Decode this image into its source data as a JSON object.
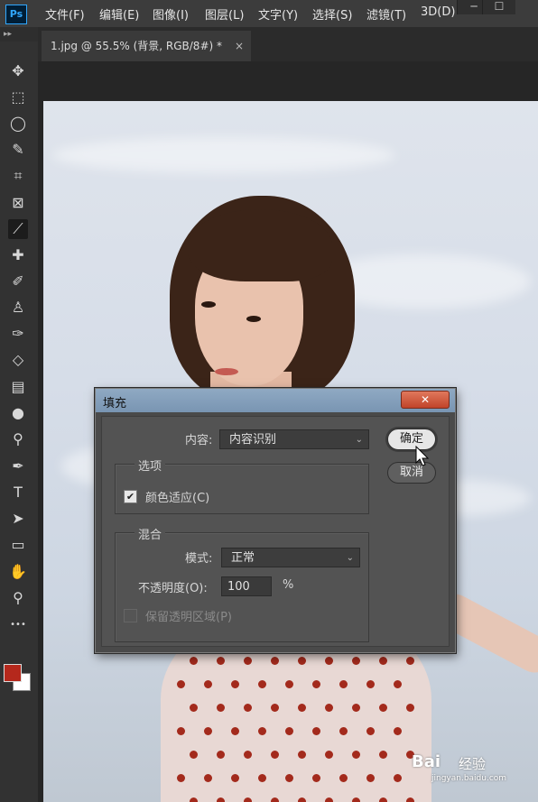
{
  "app": {
    "logo": "Ps",
    "menu": [
      "文件(F)",
      "编辑(E)",
      "图像(I)",
      "图层(L)",
      "文字(Y)",
      "选择(S)",
      "滤镜(T)",
      "3D(D)"
    ],
    "window_controls": {
      "minimize": "─",
      "maximize": "☐"
    }
  },
  "toolstrip": {
    "collapse": "▸▸"
  },
  "document": {
    "tab_title": "1.jpg @ 55.5% (背景, RGB/8#) *",
    "tab_close": "×"
  },
  "tools": [
    {
      "name": "move-tool-icon",
      "glyph": "✥"
    },
    {
      "name": "marquee-tool-icon",
      "glyph": "⬚"
    },
    {
      "name": "lasso-tool-icon",
      "glyph": "◯"
    },
    {
      "name": "quick-select-tool-icon",
      "glyph": "✎"
    },
    {
      "name": "crop-tool-icon",
      "glyph": "⌗"
    },
    {
      "name": "frame-tool-icon",
      "glyph": "⊠"
    },
    {
      "name": "eyedropper-tool-icon",
      "glyph": "⟋"
    },
    {
      "name": "healing-brush-tool-icon",
      "glyph": "✚"
    },
    {
      "name": "brush-tool-icon",
      "glyph": "✐"
    },
    {
      "name": "stamp-tool-icon",
      "glyph": "♙"
    },
    {
      "name": "history-brush-tool-icon",
      "glyph": "✑"
    },
    {
      "name": "eraser-tool-icon",
      "glyph": "◇"
    },
    {
      "name": "gradient-tool-icon",
      "glyph": "▤"
    },
    {
      "name": "blur-tool-icon",
      "glyph": "●"
    },
    {
      "name": "dodge-tool-icon",
      "glyph": "⚲"
    },
    {
      "name": "pen-tool-icon",
      "glyph": "✒"
    },
    {
      "name": "type-tool-icon",
      "glyph": "T"
    },
    {
      "name": "path-select-tool-icon",
      "glyph": "➤"
    },
    {
      "name": "rectangle-tool-icon",
      "glyph": "▭"
    },
    {
      "name": "hand-tool-icon",
      "glyph": "✋"
    },
    {
      "name": "zoom-tool-icon",
      "glyph": "⚲"
    },
    {
      "name": "more-tools-icon",
      "glyph": "•••"
    }
  ],
  "colors": {
    "foreground": "#b5281c",
    "background": "#ffffff"
  },
  "dialog": {
    "title": "填充",
    "close": "✕",
    "contents_label": "内容:",
    "contents_value": "内容识别",
    "options_group": "选项",
    "color_adapt_label": "颜色适应(C)",
    "color_adapt_checked": true,
    "blend_group": "混合",
    "mode_label": "模式:",
    "mode_value": "正常",
    "opacity_label": "不透明度(O):",
    "opacity_value": "100",
    "opacity_unit": "%",
    "preserve_label": "保留透明区域(P)",
    "preserve_checked": false,
    "ok_label": "确定",
    "cancel_label": "取消"
  },
  "watermark": {
    "brand": "Bai",
    "sub": "经验",
    "url": "jingyan.baidu.com"
  }
}
